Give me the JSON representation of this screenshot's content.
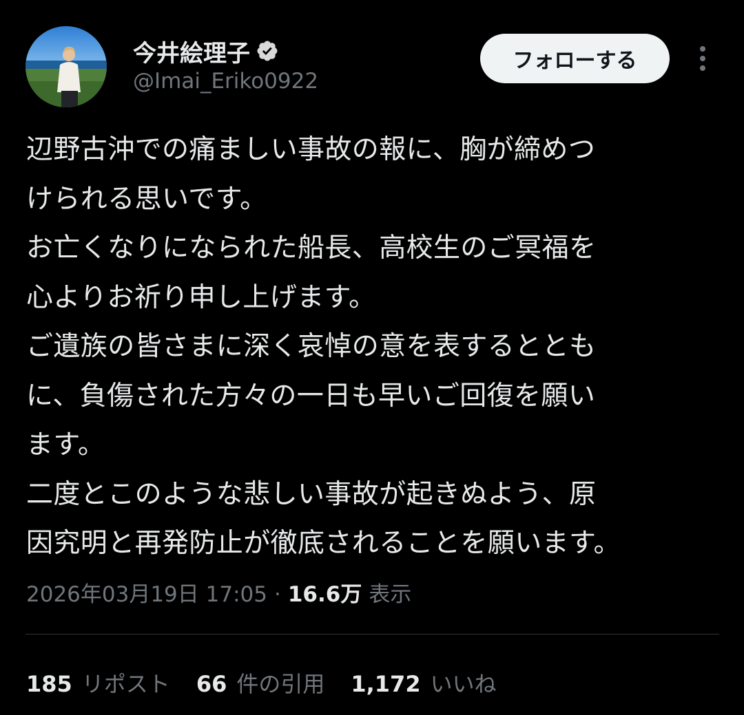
{
  "author": {
    "display_name": "今井絵理子",
    "handle": "@Imai_Eriko0922",
    "verified": true,
    "avatar_icon": "profile-photo"
  },
  "actions": {
    "follow_label": "フォローする",
    "more_icon": "vertical-ellipsis-icon"
  },
  "tweet": {
    "lines": [
      "辺野古沖での痛ましい事故の報に、胸が締めつ",
      "けられる思いです。",
      "お亡くなりになられた船長、高校生のご冥福を",
      "心よりお祈り申し上げます。",
      "ご遺族の皆さまに深く哀悼の意を表するととも",
      "に、負傷された方々の一日も早いご回復を願い",
      "ます。",
      "二度とこのような悲しい事故が起きぬよう、原",
      "因究明と再発防止が徹底されることを願います。"
    ]
  },
  "meta": {
    "timestamp": "2026年03月19日 17:05",
    "separator": "·",
    "views_count": "16.6万",
    "views_label": "表示"
  },
  "stats": {
    "reposts_count": "185",
    "reposts_label": "リポスト",
    "quotes_count": "66",
    "quotes_label": "件の引用",
    "likes_count": "1,172",
    "likes_label": "いいね"
  },
  "colors": {
    "background": "#000000",
    "primary_text": "#e7e9ea",
    "secondary_text": "#71767b",
    "verified_badge": "#d9d9d9",
    "follow_button_bg": "#eff3f4",
    "divider": "#2f3336"
  }
}
